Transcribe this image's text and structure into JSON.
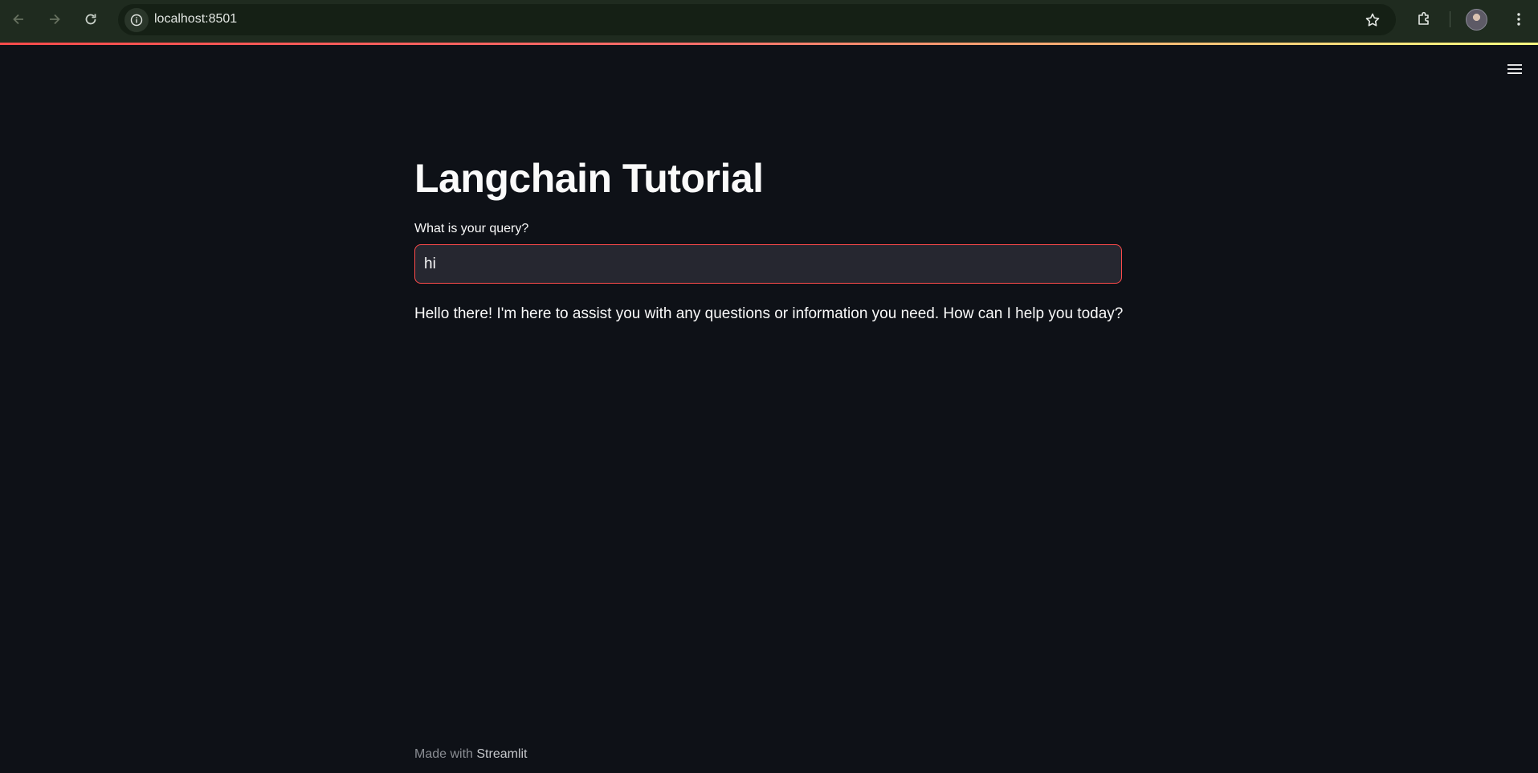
{
  "browser": {
    "url": "localhost:8501",
    "icons": {
      "back": "arrow-left-icon",
      "forward": "arrow-right-icon",
      "reload": "reload-icon",
      "site_info": "info-icon",
      "bookmark": "star-icon",
      "extensions": "puzzle-icon",
      "profile": "avatar",
      "menu": "vertical-dots-icon"
    }
  },
  "app": {
    "title": "Langchain Tutorial",
    "query_label": "What is your query?",
    "query_value": "hi",
    "response": "Hello there! I'm here to assist you with any questions or information you need. How can I help you today?",
    "footer_prefix": "Made with ",
    "footer_brand": "Streamlit"
  },
  "colors": {
    "background": "#0e1117",
    "text": "#fafafa",
    "input_background": "#262730",
    "input_focus_border": "#ff4b4b",
    "accent_gradient_start": "#ff4b4b",
    "accent_gradient_end": "#fffd80",
    "chrome_background": "#1f2b1f"
  }
}
